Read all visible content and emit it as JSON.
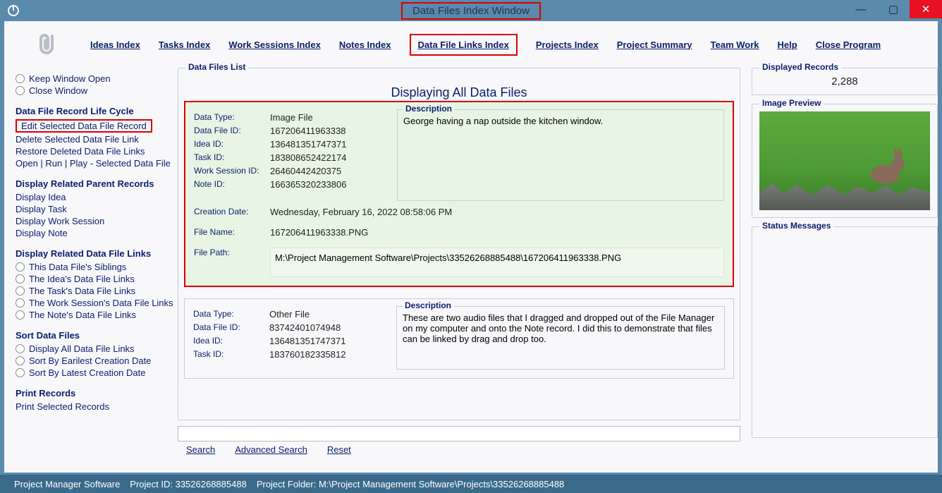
{
  "window": {
    "title": "Data Files Index Window"
  },
  "nav": {
    "items": [
      "Ideas Index",
      "Tasks Index",
      "Work Sessions Index",
      "Notes Index",
      "Data File Links Index",
      "Projects Index",
      "Project Summary",
      "Team Work",
      "Help",
      "Close Program"
    ],
    "highlight_index": 4
  },
  "sidebar": {
    "window_opts": {
      "keep_open": "Keep Window Open",
      "close_window": "Close Window"
    },
    "lifecycle": {
      "head": "Data File Record Life Cycle",
      "edit": "Edit Selected Data File Record",
      "delete": "Delete Selected Data File Link",
      "restore": "Restore Deleted Data File Links",
      "openrun": "Open | Run | Play - Selected Data File"
    },
    "parent": {
      "head": "Display Related Parent Records",
      "idea": "Display Idea",
      "task": "Display Task",
      "ws": "Display Work Session",
      "note": "Display Note"
    },
    "links": {
      "head": "Display Related Data File Links",
      "siblings": "This Data File's Siblings",
      "idea": "The Idea's Data File Links",
      "task": "The Task's Data File Links",
      "ws": "The Work Session's Data File Links",
      "note": "The Note's Data File Links"
    },
    "sort": {
      "head": "Sort Data Files",
      "all": "Display All Data File Links",
      "earliest": "Sort By Earilest Creation Date",
      "latest": "Sort By Latest Creation Date"
    },
    "print": {
      "head": "Print Records",
      "selected": "Print Selected Records"
    }
  },
  "center": {
    "fs_title": "Data Files List",
    "list_title": "Displaying All Data Files",
    "labels": {
      "data_type": "Data Type:",
      "data_file_id": "Data File ID:",
      "idea_id": "Idea ID:",
      "task_id": "Task ID:",
      "ws_id": "Work Session ID:",
      "note_id": "Note ID:",
      "creation": "Creation Date:",
      "file_name": "File Name:",
      "file_path": "File Path:",
      "desc": "Description"
    },
    "records": [
      {
        "data_type": "Image File",
        "data_file_id": "167206411963338",
        "idea_id": "136481351747371",
        "task_id": "183808652422174",
        "ws_id": "26460442420375",
        "note_id": "166365320233806",
        "creation": "Wednesday, February 16, 2022   08:58:06 PM",
        "file_name": "167206411963338.PNG",
        "file_path": "M:\\Project Management Software\\Projects\\33526268885488\\167206411963338.PNG",
        "desc": "George having a nap outside the kitchen window.",
        "selected": true
      },
      {
        "data_type": "Other File",
        "data_file_id": "83742401074948",
        "idea_id": "136481351747371",
        "task_id": "183760182335812",
        "desc": "These are two audio files that I dragged and dropped out of the File Manager on my computer and onto the Note record. I did this to demonstrate that files can be linked by drag and drop too.",
        "selected": false
      }
    ],
    "search": {
      "search": "Search",
      "advanced": "Advanced Search",
      "reset": "Reset"
    }
  },
  "right": {
    "disp_head": "Displayed Records",
    "disp_count": "2,288",
    "preview_head": "Image Preview",
    "status_head": "Status Messages"
  },
  "statusbar": {
    "app": "Project Manager Software",
    "project_id": "Project ID:  33526268885488",
    "project_folder": "Project Folder:  M:\\Project Management Software\\Projects\\33526268885488"
  }
}
